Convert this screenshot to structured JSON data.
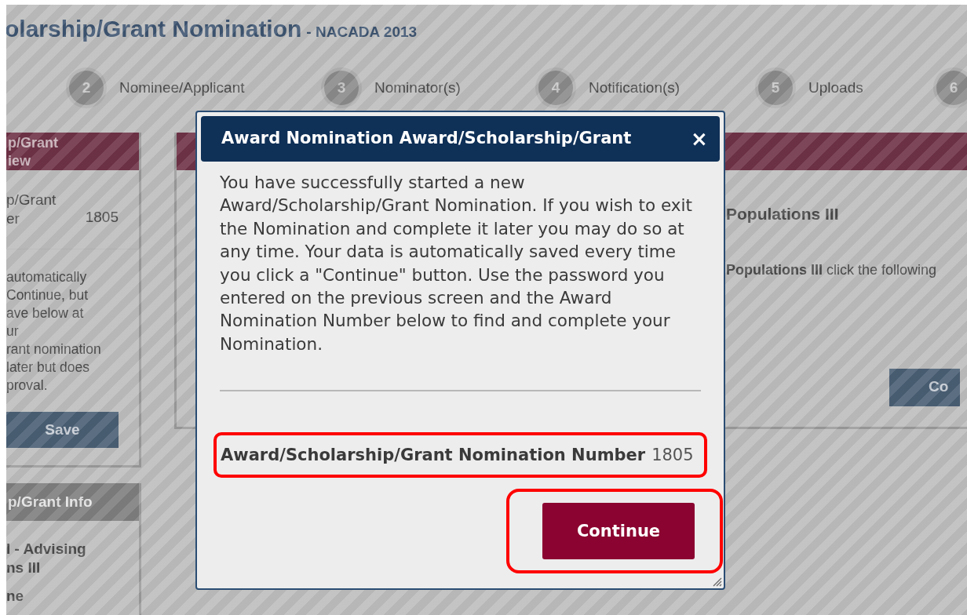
{
  "page": {
    "title": "olarship/Grant Nomination",
    "subtitle": "- NACADA 2013"
  },
  "steps": [
    {
      "number": "2",
      "label": "Nominee/Applicant"
    },
    {
      "number": "3",
      "label": "Nominator(s)"
    },
    {
      "number": "4",
      "label": "Notification(s)"
    },
    {
      "number": "5",
      "label": "Uploads"
    },
    {
      "number": "6"
    }
  ],
  "sidebar": {
    "overview": {
      "title_lines": [
        "p/Grant",
        "iew"
      ],
      "number_label_lines": [
        "p/Grant",
        "er"
      ],
      "number": "1805",
      "note_lines": [
        "automatically",
        "Continue, but",
        "ave below at",
        "ur",
        "rant nomination",
        "later but does",
        "proval."
      ],
      "save_button": "Save"
    },
    "info": {
      "title": "p/Grant Info",
      "name_lines": [
        "I - Advising",
        "ns III"
      ],
      "line_3": "ne"
    }
  },
  "main": {
    "heading": "Populations III",
    "instruction": "**Populations III** click the following",
    "button": "Co"
  },
  "modal": {
    "title": "Award Nomination Award/Scholarship/Grant",
    "close": "×",
    "message": "You have successfully started a new Award/Scholarship/Grant Nomination. If you wish to exit the Nomination and complete it later you may do so at any time. Your data is automatically saved every time you click a \"Continue\" button. Use the password you entered on the previous screen and the Award Nomination Number below to find and complete your Nomination.",
    "number_label": "Award/Scholarship/Grant Nomination Number",
    "number": "1805",
    "button": "Continue"
  }
}
